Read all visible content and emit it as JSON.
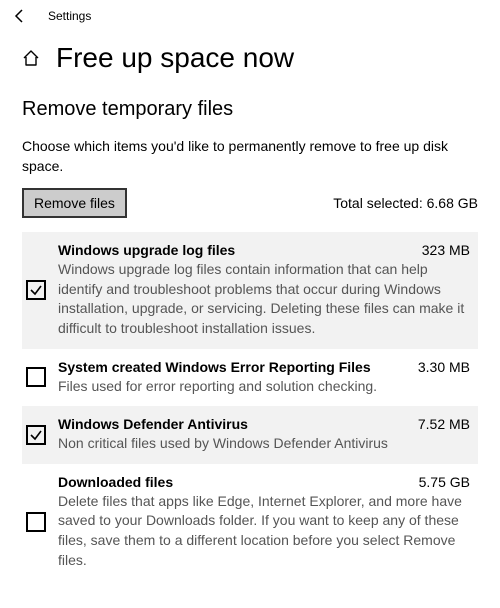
{
  "header": {
    "app_name": "Settings"
  },
  "page": {
    "title": "Free up space now"
  },
  "section": {
    "heading": "Remove temporary files",
    "instructions": "Choose which items you'd like to permanently remove to free up disk space.",
    "remove_button": "Remove files",
    "total_selected_label": "Total selected: 6.68 GB"
  },
  "items": [
    {
      "title": "Windows upgrade log files",
      "size": "323 MB",
      "desc": "Windows upgrade log files contain information that can help identify and troubleshoot problems that occur during Windows installation, upgrade, or servicing.  Deleting these files can make it difficult to troubleshoot installation issues.",
      "checked": true
    },
    {
      "title": "System created Windows Error Reporting Files",
      "size": "3.30 MB",
      "desc": "Files used for error reporting and solution checking.",
      "checked": false
    },
    {
      "title": "Windows Defender Antivirus",
      "size": "7.52 MB",
      "desc": "Non critical files used by Windows Defender Antivirus",
      "checked": true
    },
    {
      "title": "Downloaded files",
      "size": "5.75 GB",
      "desc": "Delete files that apps like Edge, Internet Explorer, and more have saved to your Downloads folder. If you want to keep any of these files, save them to a different location before you select Remove files.",
      "checked": false
    }
  ]
}
